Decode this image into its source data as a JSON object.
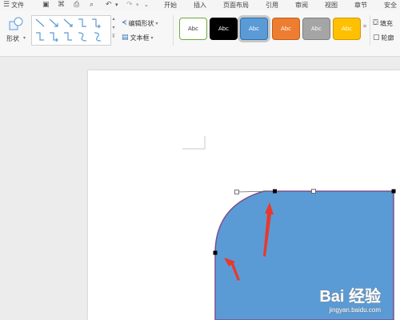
{
  "menu": {
    "file_icon": "hamburger-icon",
    "file_label": "文件",
    "tabs": [
      "开始",
      "插入",
      "页面布局",
      "引用",
      "审阅",
      "视图",
      "章节",
      "安全"
    ]
  },
  "ribbon": {
    "shape_label": "形状",
    "edit_shape_label": "编辑形状",
    "textbox_label": "文本框",
    "style_sample": "Abc",
    "fill_label": "填充",
    "outline_label": "轮廓",
    "styles": [
      {
        "bg": "#ffffff",
        "border": "#6aaa3a",
        "text": "#333333"
      },
      {
        "bg": "#000000",
        "border": "#000000",
        "text": "#ffffff"
      },
      {
        "bg": "#5b9bd5",
        "border": "#2f6fb0",
        "text": "#ffffff",
        "selected": true
      },
      {
        "bg": "#ed7d31",
        "border": "#c05f1a",
        "text": "#ffffff"
      },
      {
        "bg": "#a5a5a5",
        "border": "#7f7f7f",
        "text": "#ffffff"
      },
      {
        "bg": "#ffc000",
        "border": "#d09a00",
        "text": "#ffffff"
      }
    ]
  },
  "shape": {
    "fill": "#5b9bd5",
    "outline": "#7a5090",
    "annotation_color": "#e8392e"
  },
  "watermark": {
    "logo": "Bai 经验",
    "url": "jingyan.baidu.com"
  }
}
